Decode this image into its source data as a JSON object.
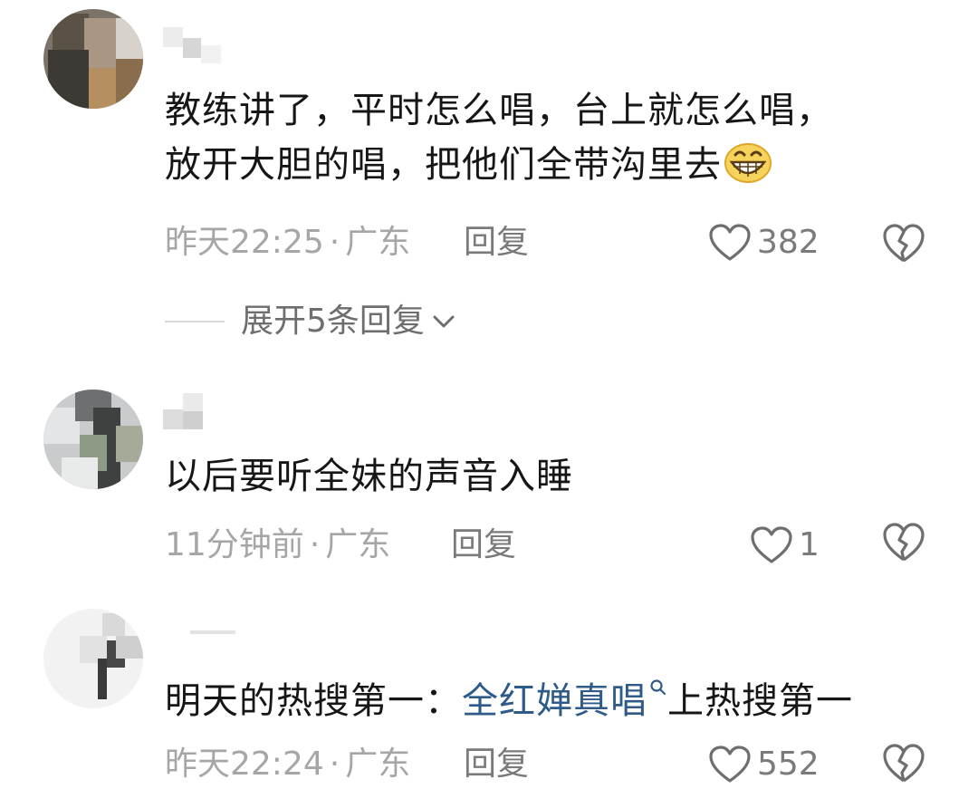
{
  "comments": [
    {
      "text_line1": "教练讲了，平时怎么唱，台上就怎么唱，",
      "text_line2": "放开大胆的唱，把他们全带沟里去",
      "emoji": "grinning-face-emoji",
      "time": "昨天22:25",
      "dot": "·",
      "location": "广东",
      "reply_label": "回复",
      "likes": "382",
      "expand_label": "展开5条回复"
    },
    {
      "text": "以后要听全妹的声音入睡",
      "time": "11分钟前",
      "dot": "·",
      "location": "广东",
      "reply_label": "回复",
      "likes": "1"
    },
    {
      "text_prefix": "明天的热搜第一：",
      "hashtag": "全红婵真唱",
      "text_suffix": "上热搜第一",
      "time": "昨天22:24",
      "dot": "·",
      "location": "广东",
      "reply_label": "回复",
      "likes": "552"
    }
  ],
  "icons": {
    "like": "heart-outline-icon",
    "dislike": "broken-heart-icon",
    "expand": "chevron-down-icon",
    "hashtag_search": "search-icon"
  },
  "colors": {
    "text": "#161616",
    "meta": "#a6a6a6",
    "action": "#7a7a7a",
    "hashtag": "#2f5b8a"
  }
}
